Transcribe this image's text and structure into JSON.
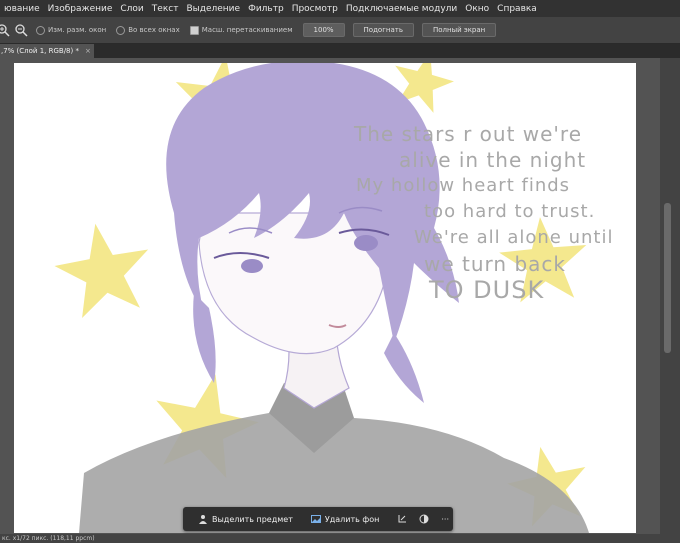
{
  "menu": [
    "ювание",
    "Изображение",
    "Слои",
    "Текст",
    "Выделение",
    "Фильтр",
    "Просмотр",
    "Подключаемые модули",
    "Окно",
    "Справка"
  ],
  "options": {
    "resize_windows": "Изм. разм. окон",
    "all_windows": "Во всех окнах",
    "scrubby_zoom": "Масш. перетаскиванием",
    "zoom_value": "100%",
    "fit_button": "Подогнать",
    "fullscreen_button": "Полный экран"
  },
  "tab": {
    "title": ",7% (Слой 1, RGB/8) *",
    "close": "×"
  },
  "lyrics": [
    "The stars r out we're",
    "alive in the night",
    "My hollow heart finds",
    "too hard to trust.",
    "We're all alone until",
    "we turn back",
    "TO DUSK"
  ],
  "context_bar": {
    "select_subject": "Выделить предмет",
    "remove_bg": "Удалить фон",
    "more": "···"
  },
  "status": "кс. х1/72 пикс. (118,11 ppcm)",
  "colors": {
    "hair": "#b3a6d6",
    "star": "#f2e47a",
    "shirt": "#a4a4a4",
    "lyrics_text": "#a8a8a8"
  }
}
